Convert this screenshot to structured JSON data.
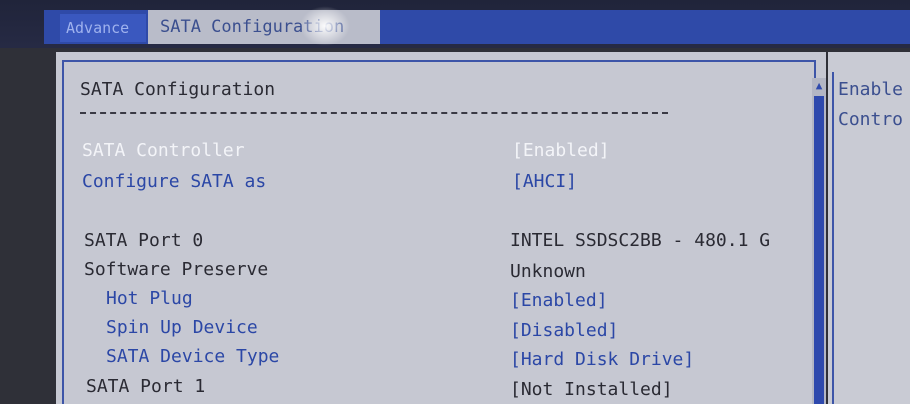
{
  "tabs": {
    "previous": "Advance",
    "active": "SATA Configuration"
  },
  "section_title": "SATA Configuration",
  "divider": "----------------------------------------------",
  "settings": [
    {
      "label": "SATA Controller",
      "value": "[Enabled]"
    },
    {
      "label": "Configure SATA as",
      "value": "[AHCI]"
    },
    {
      "label": "SATA Port 0",
      "value": "INTEL SSDSC2BB - 480.1 G"
    },
    {
      "label": "Software Preserve",
      "value": "Unknown"
    },
    {
      "label": "Hot Plug",
      "value": "[Enabled]"
    },
    {
      "label": "Spin Up Device",
      "value": "[Disabled]"
    },
    {
      "label": "SATA Device Type",
      "value": "[Hard Disk Drive]"
    },
    {
      "label": "SATA Port 1",
      "value": "[Not Installed]"
    }
  ],
  "help": {
    "line1": "Enable",
    "line2": "Contro"
  },
  "colors": {
    "panel_bg": "#c6c8d2",
    "accent_blue": "#2b47a6",
    "highlight_white": "#f3f4f8",
    "tab_bar": "#2f4aa8"
  }
}
